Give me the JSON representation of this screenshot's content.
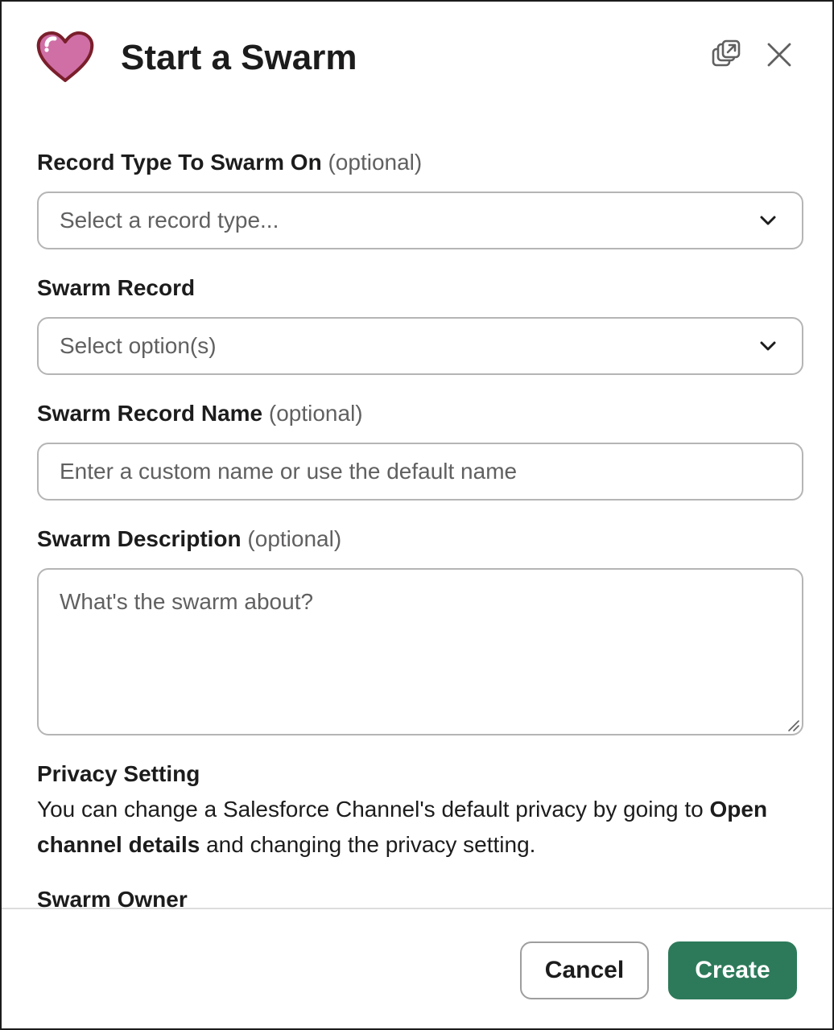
{
  "modal": {
    "title": "Start a Swarm",
    "icon": "heart-icon",
    "accent_color": "#2d7a5a"
  },
  "fields": {
    "record_type": {
      "label": "Record Type To Swarm On",
      "optional": "(optional)",
      "placeholder": "Select a record type..."
    },
    "swarm_record": {
      "label": "Swarm Record",
      "placeholder": "Select option(s)"
    },
    "swarm_record_name": {
      "label": "Swarm Record Name",
      "optional": "(optional)",
      "placeholder": "Enter a custom name or use the default name"
    },
    "swarm_description": {
      "label": "Swarm Description",
      "optional": "(optional)",
      "placeholder": "What's the swarm about?"
    },
    "privacy": {
      "label": "Privacy Setting",
      "text_before": "You can change a Salesforce Channel's default privacy by going to ",
      "text_bold": "Open channel details",
      "text_after": " and changing the privacy setting."
    },
    "swarm_owner": {
      "label": "Swarm Owner"
    }
  },
  "footer": {
    "cancel_label": "Cancel",
    "create_label": "Create"
  }
}
